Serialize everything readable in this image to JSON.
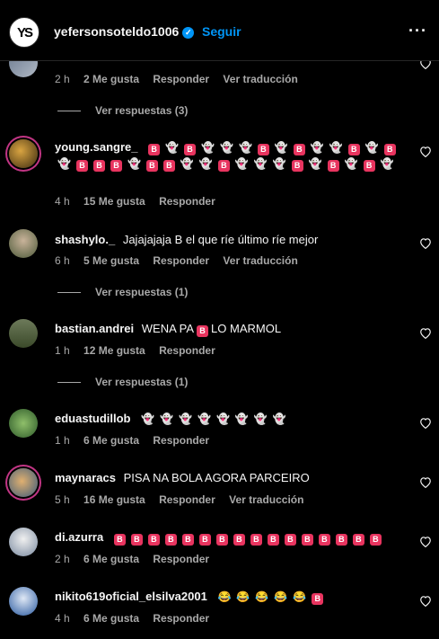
{
  "header": {
    "username": "yefersonsoteldo1006",
    "follow_label": "Seguir",
    "logo_text": "YS"
  },
  "comments": [
    {
      "username": "",
      "text": "",
      "time": "2 h",
      "likes": "2 Me gusta",
      "reply": "Responder",
      "translate": "Ver traducción",
      "replies": "Ver respuestas (3)"
    },
    {
      "username": "young.sangre_",
      "emoji_seq": "BGBGGGBGBGGBGBGBBBGBBGGBGGGBGBGBG",
      "time": "4 h",
      "likes": "15 Me gusta",
      "reply": "Responder"
    },
    {
      "username": "shashylo._",
      "text": "Jajajajaja B el que ríe último ríe mejor",
      "time": "6 h",
      "likes": "5 Me gusta",
      "reply": "Responder",
      "translate": "Ver traducción",
      "replies": "Ver respuestas (1)"
    },
    {
      "username": "bastian.andrei",
      "text_before": "WENA PA",
      "text_after": "LO MARMOL",
      "time": "1 h",
      "likes": "12 Me gusta",
      "reply": "Responder",
      "replies": "Ver respuestas (1)"
    },
    {
      "username": "eduastudillob",
      "emoji_seq": "GGGGGGGG",
      "time": "1 h",
      "likes": "6 Me gusta",
      "reply": "Responder"
    },
    {
      "username": "maynaracs",
      "text": "PISA NA BOLA AGORA PARCEIRO",
      "time": "5 h",
      "likes": "16 Me gusta",
      "reply": "Responder",
      "translate": "Ver traducción"
    },
    {
      "username": "di.azurra",
      "emoji_seq": "BBBBBBBBBBBBBBBB",
      "time": "2 h",
      "likes": "6 Me gusta",
      "reply": "Responder"
    },
    {
      "username": "nikito619oficial_elsilva2001",
      "emoji_seq": "LLLLLB",
      "time": "4 h",
      "likes": "6 Me gusta",
      "reply": "Responder"
    }
  ],
  "emoji": {
    "B": "B",
    "G": "👻",
    "L": "😂"
  },
  "colors": {
    "accent": "#0095f6",
    "b_emoji": "#e8345f",
    "muted": "#a8a8a8",
    "background": "#000000"
  }
}
